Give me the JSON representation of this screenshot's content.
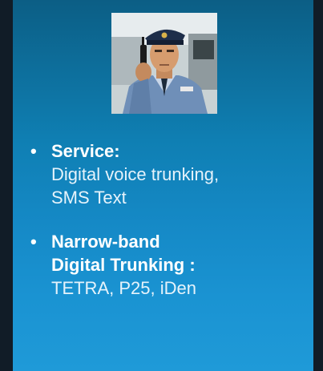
{
  "photo": {
    "icon": "officer-with-radio-photo"
  },
  "bullets": [
    {
      "marker": "•",
      "title": "Service:",
      "description_lines": [
        "Digital voice trunking,",
        "SMS Text"
      ]
    },
    {
      "marker": "•",
      "title_lines": [
        "Narrow-band",
        "Digital Trunking :"
      ],
      "description": "TETRA, P25, iDen"
    }
  ],
  "colors": {
    "background": "#111c27",
    "panel_top": "#0c5e85",
    "panel_bottom": "#1f9ad8",
    "text": "#ffffff"
  }
}
